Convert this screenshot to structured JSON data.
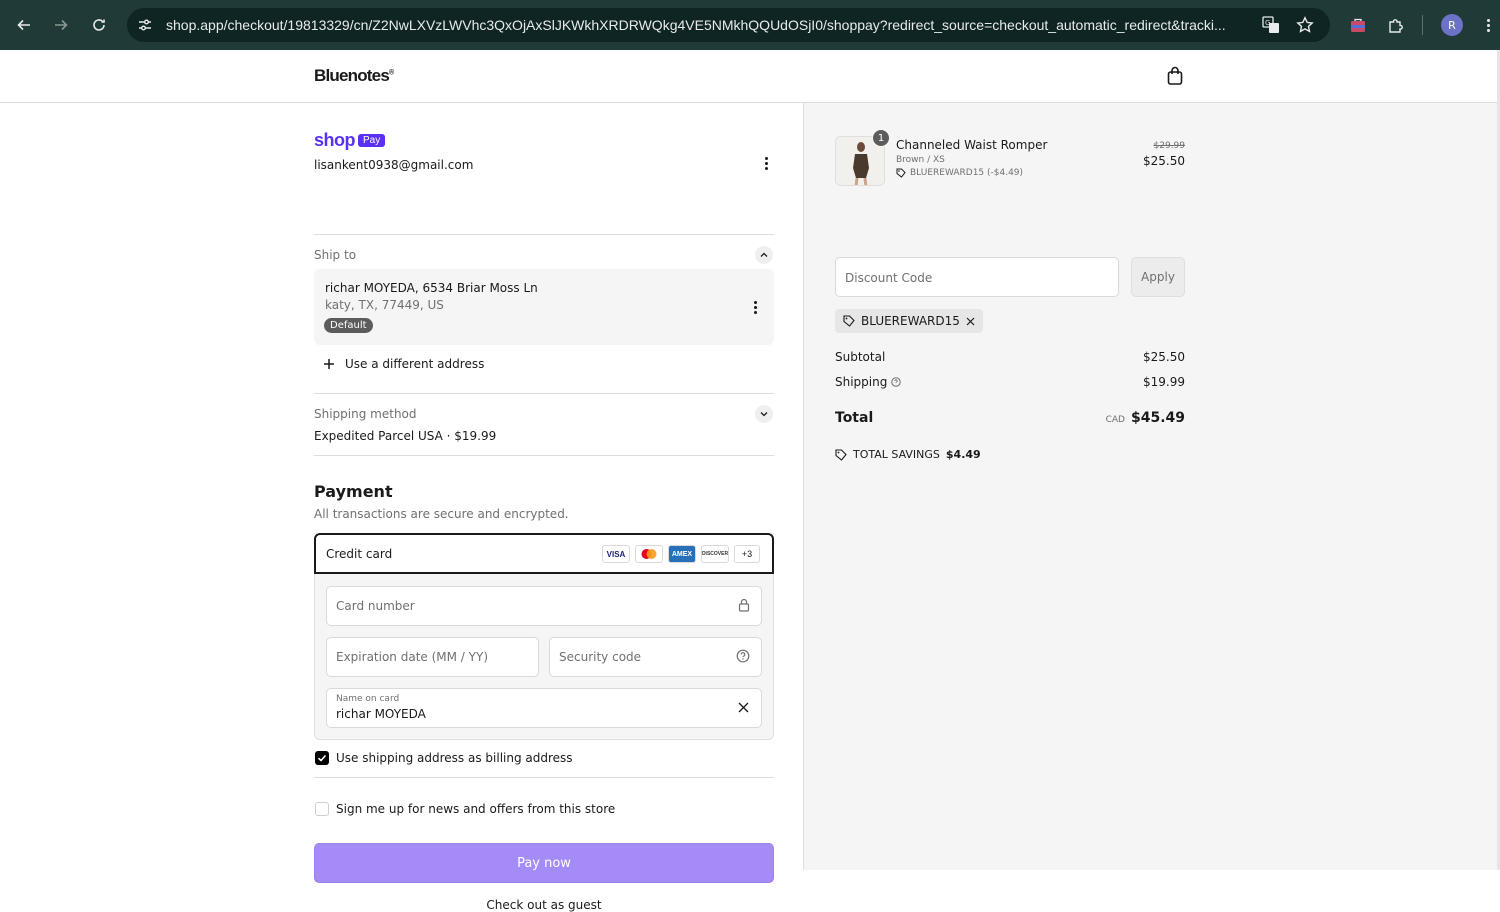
{
  "browser": {
    "url": "shop.app/checkout/19813329/cn/Z2NwLXVzLWVhc3QxOjAxSlJKWkhXRDRWQkg4VE5NMkhQQUdOSjI0/shoppay?redirect_source=checkout_automatic_redirect&tracki...",
    "profile_initial": "R"
  },
  "store": {
    "logo": "Bluenotes",
    "logo_mark": "®"
  },
  "shoppay": {
    "word": "shop",
    "badge": "Pay",
    "email": "lisankent0938@gmail.com"
  },
  "ship_to": {
    "label": "Ship to",
    "name_line": "richar MOYEDA, 6534 Briar Moss Ln",
    "city_line": "katy, TX, 77449, US",
    "badge": "Default",
    "different_address": "Use a different address"
  },
  "shipping_method": {
    "label": "Shipping method",
    "value": "Expedited Parcel USA · $19.99"
  },
  "payment": {
    "title": "Payment",
    "subtitle": "All transactions are secure and encrypted.",
    "method": "Credit card",
    "card_logos": [
      "VISA",
      "MC",
      "AMEX",
      "DISCOVER",
      "+3"
    ],
    "card_number_placeholder": "Card number",
    "expiration_placeholder": "Expiration date (MM / YY)",
    "security_placeholder": "Security code",
    "name_label": "Name on card",
    "name_value": "richar MOYEDA",
    "billing_checkbox": "Use shipping address as billing address",
    "billing_checked": true,
    "news_checkbox": "Sign me up for news and offers from this store",
    "news_checked": false,
    "pay_button": "Pay now",
    "guest_link": "Check out as guest"
  },
  "summary": {
    "item": {
      "quantity": "1",
      "name": "Channeled Waist Romper",
      "variant": "Brown / XS",
      "discount": "BLUEREWARD15 (-$4.49)",
      "original_price": "$29.99",
      "price": "$25.50"
    },
    "discount_placeholder": "Discount Code",
    "apply_label": "Apply",
    "applied_code": "BLUEREWARD15",
    "subtotal_label": "Subtotal",
    "subtotal": "$25.50",
    "shipping_label": "Shipping",
    "shipping": "$19.99",
    "total_label": "Total",
    "currency": "CAD",
    "total": "$45.49",
    "savings_label": "TOTAL SAVINGS",
    "savings": "$4.49"
  },
  "colors": {
    "accent": "#5a31f4",
    "pay_button": "#a58bf5",
    "chrome": "#1f3a37"
  }
}
